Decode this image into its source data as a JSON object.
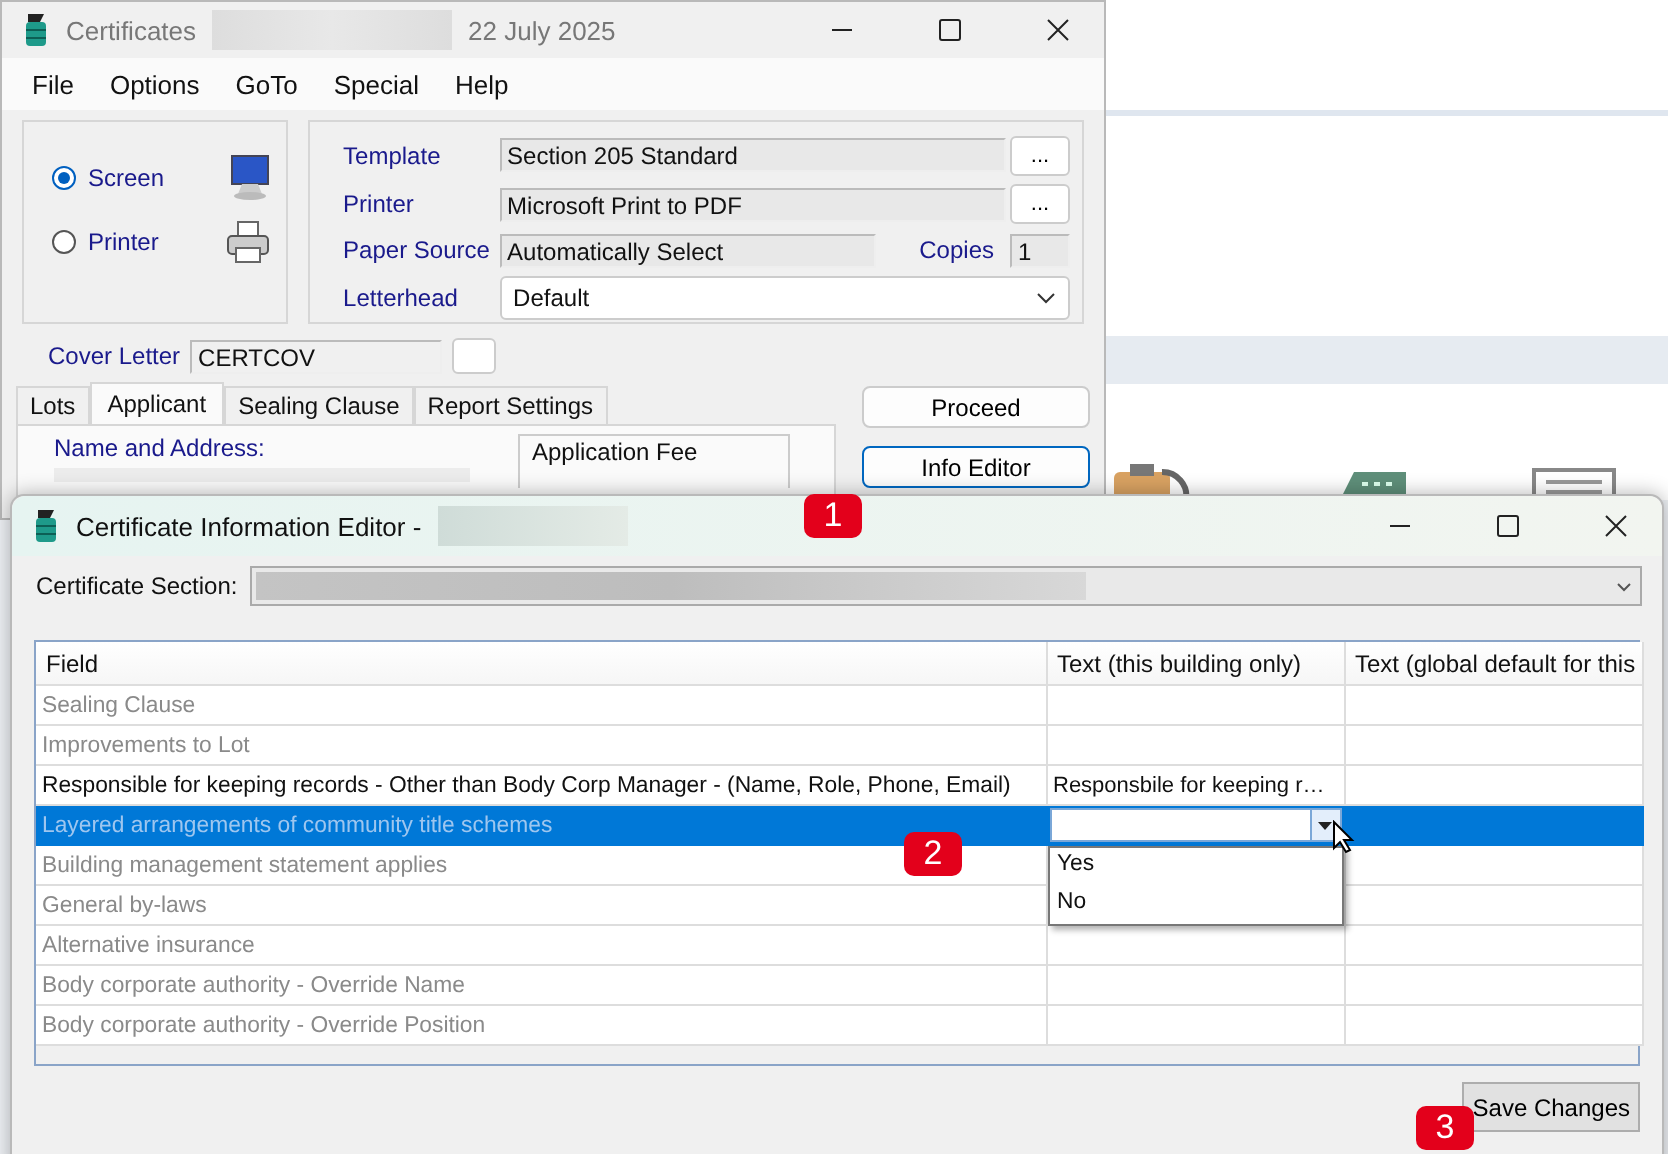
{
  "main_window": {
    "title": "Certificates",
    "date": "22 July 2025",
    "menu": [
      "File",
      "Options",
      "GoTo",
      "Special",
      "Help"
    ],
    "output": [
      {
        "label": "Screen",
        "selected": true,
        "kind": "screen"
      },
      {
        "label": "Printer",
        "selected": false,
        "kind": "printer"
      }
    ],
    "settings": [
      {
        "label": "Template",
        "value": "Section 205 Standard",
        "kind": "browse",
        "button": "..."
      },
      {
        "label": "Printer",
        "value": "Microsoft Print to PDF",
        "kind": "browse",
        "button": "..."
      },
      {
        "label": "Paper Source",
        "value": "Automatically Select",
        "kind": "copies",
        "copies_label": "Copies",
        "copies": "1"
      },
      {
        "label": "Letterhead",
        "value": "Default",
        "kind": "combo"
      }
    ],
    "cover_letter": {
      "label": "Cover Letter",
      "value": "CERTCOV"
    },
    "tabs": [
      {
        "label": "Lots",
        "selected": false
      },
      {
        "label": "Applicant",
        "selected": true
      },
      {
        "label": "Sealing Clause",
        "selected": false
      },
      {
        "label": "Report Settings",
        "selected": false
      }
    ],
    "name_and_address": {
      "label": "Name and Address:"
    },
    "application_fee": {
      "label": "Application Fee"
    },
    "buttons": [
      {
        "label": "Proceed",
        "focused": false
      },
      {
        "label": "Info Editor",
        "focused": true
      }
    ]
  },
  "editor": {
    "title": "Certificate Information Editor -",
    "section_label": "Certificate Section:",
    "columns": [
      "Field",
      "Text (this building only)",
      "Text (global default for this"
    ],
    "rows": [
      {
        "field": "Sealing Clause",
        "text": "",
        "disabled": true,
        "selected": false
      },
      {
        "field": "Improvements to Lot",
        "text": "",
        "disabled": true,
        "selected": false
      },
      {
        "field": "Responsible for keeping records - Other than Body Corp Manager - (Name, Role, Phone, Email)",
        "text": "Responsbile for keeping r…",
        "disabled": false,
        "selected": false
      },
      {
        "field": "Layered arrangements of community title schemes",
        "text": "",
        "disabled": true,
        "selected": true,
        "dropdown": {
          "options": [
            "Yes",
            "No"
          ]
        }
      },
      {
        "field": "Building management statement applies",
        "text": "",
        "disabled": true,
        "selected": false
      },
      {
        "field": "General by-laws",
        "text": "",
        "disabled": true,
        "selected": false
      },
      {
        "field": "Alternative insurance",
        "text": "",
        "disabled": true,
        "selected": false
      },
      {
        "field": "Body corporate authority - Override Name",
        "text": "",
        "disabled": true,
        "selected": false
      },
      {
        "field": "Body corporate authority - Override Position",
        "text": "",
        "disabled": true,
        "selected": false
      }
    ],
    "save_button": "Save Changes"
  },
  "callouts": [
    "1",
    "2",
    "3"
  ]
}
